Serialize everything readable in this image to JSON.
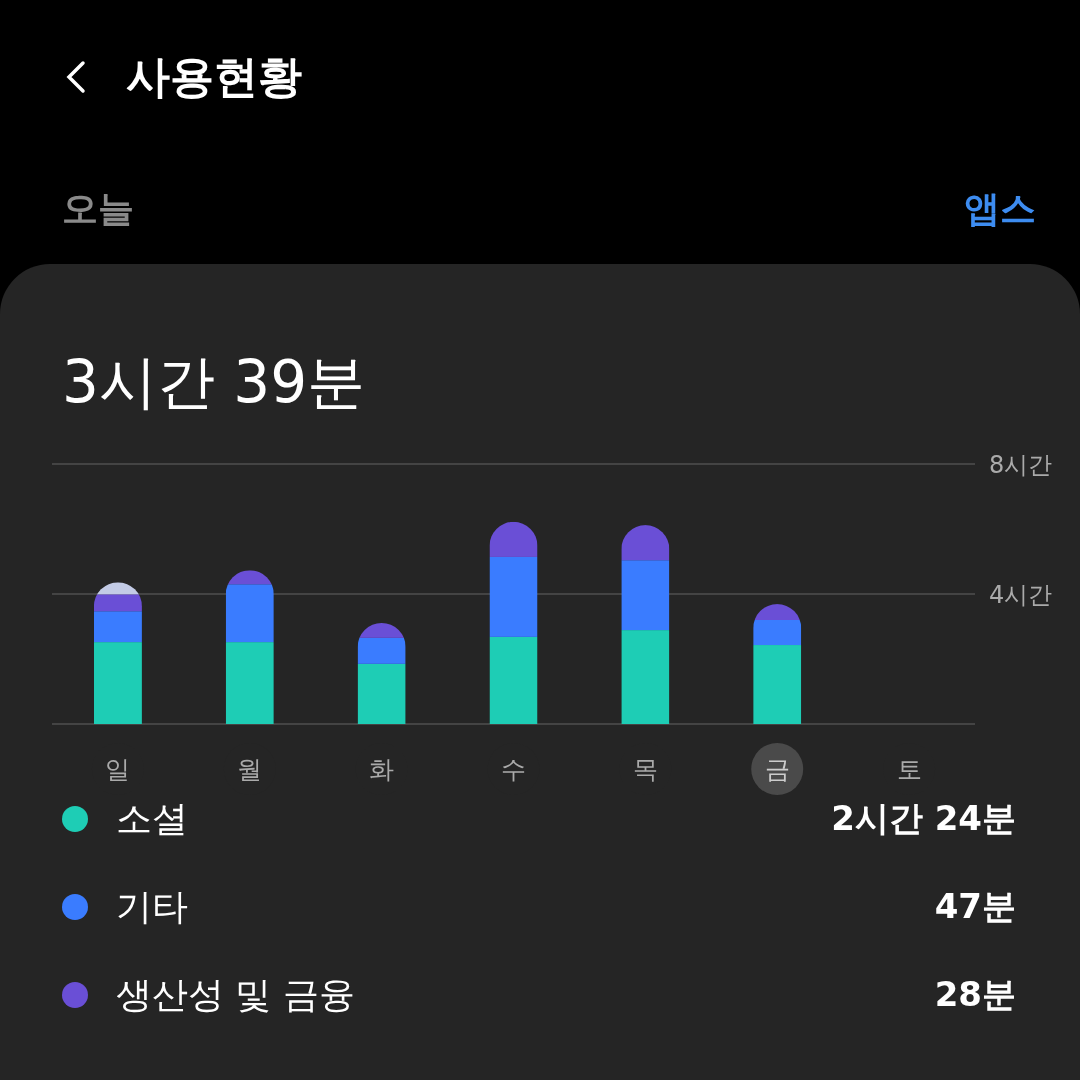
{
  "header": {
    "title": "사용현황"
  },
  "subheader": {
    "period": "오늘",
    "link": "앱스"
  },
  "summary": {
    "total": "3시간 39분"
  },
  "days": [
    {
      "selected": false
    },
    {
      "selected": false
    },
    {
      "selected": false
    },
    {
      "selected": false
    },
    {
      "selected": false
    },
    {
      "selected": true
    },
    {
      "selected": false
    }
  ],
  "chart_data": {
    "type": "bar",
    "stacked": true,
    "categories": [
      "일",
      "월",
      "화",
      "수",
      "목",
      "금",
      "토"
    ],
    "ylim": [
      0,
      8
    ],
    "yticks": [
      {
        "value": 4,
        "label": "4시간"
      },
      {
        "value": 8,
        "label": "8시간"
      }
    ],
    "series": [
      {
        "name": "소셜",
        "color": "#1ecdb5",
        "values": [
          2.52,
          2.52,
          1.85,
          2.68,
          2.89,
          2.43,
          null
        ]
      },
      {
        "name": "기타",
        "color": "#3a7cff",
        "values": [
          0.95,
          1.78,
          0.8,
          2.46,
          2.15,
          0.77,
          null
        ]
      },
      {
        "name": "생산성 및 금융",
        "color": "#6a4fd6",
        "values": [
          0.52,
          0.43,
          0.46,
          1.08,
          1.08,
          0.49,
          null
        ]
      },
      {
        "color": "#c3cbe6",
        "values": [
          0.37,
          0,
          0,
          0,
          0,
          0,
          null
        ]
      }
    ]
  },
  "legend": [
    {
      "value": "2시간 24분"
    },
    {
      "value": "47분"
    },
    {
      "value": "28분"
    }
  ]
}
